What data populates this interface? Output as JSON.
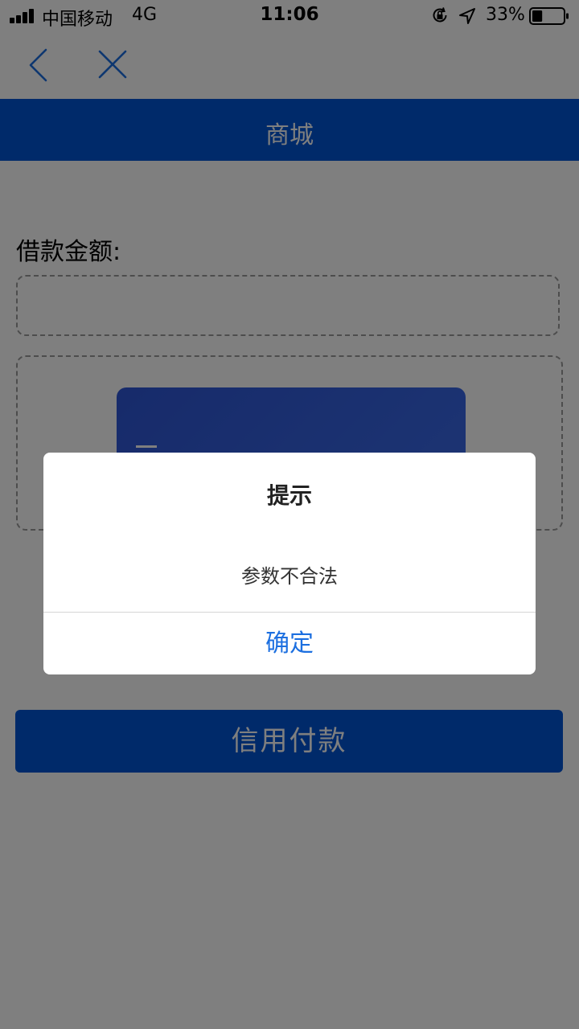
{
  "status_bar": {
    "carrier": "中国移动",
    "network": "4G",
    "time": "11:06",
    "battery": "33%",
    "battery_level": 0.33
  },
  "nav": {
    "back_icon": "chevron-left-icon",
    "close_icon": "close-icon",
    "icon_color": "#1c6fe0"
  },
  "header": {
    "title": "商城",
    "color": "#0054d4"
  },
  "form": {
    "amount_label": "借款金额:",
    "amount_value": "",
    "pay_button_label": "信用付款"
  },
  "dialog": {
    "title": "提示",
    "message": "参数不合法",
    "confirm_label": "确定"
  }
}
